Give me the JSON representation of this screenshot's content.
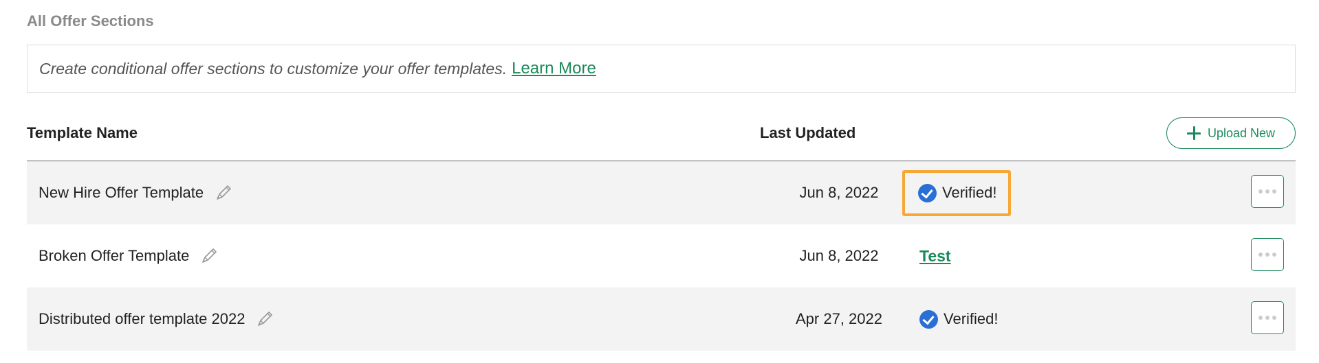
{
  "section": {
    "title": "All Offer Sections",
    "info_text": "Create conditional offer sections to customize your offer templates.",
    "learn_more": "Learn More"
  },
  "table": {
    "col_name": "Template Name",
    "col_updated": "Last Updated",
    "upload_label": "Upload New",
    "rows": [
      {
        "name": "New Hire Offer Template",
        "updated": "Jun 8, 2022",
        "status": "Verified!",
        "status_type": "verified",
        "highlighted": true
      },
      {
        "name": "Broken Offer Template",
        "updated": "Jun 8, 2022",
        "status": "Test",
        "status_type": "link",
        "highlighted": false
      },
      {
        "name": "Distributed offer template 2022",
        "updated": "Apr 27, 2022",
        "status": "Verified!",
        "status_type": "verified",
        "highlighted": false
      }
    ]
  },
  "colors": {
    "accent_green": "#1a8a5a",
    "verified_blue": "#2a6fd6",
    "highlight_orange": "#f7a734"
  },
  "icons": {
    "plus": "plus-icon",
    "pencil": "pencil-icon",
    "check": "check-circle-icon",
    "more": "more-horizontal-icon"
  }
}
